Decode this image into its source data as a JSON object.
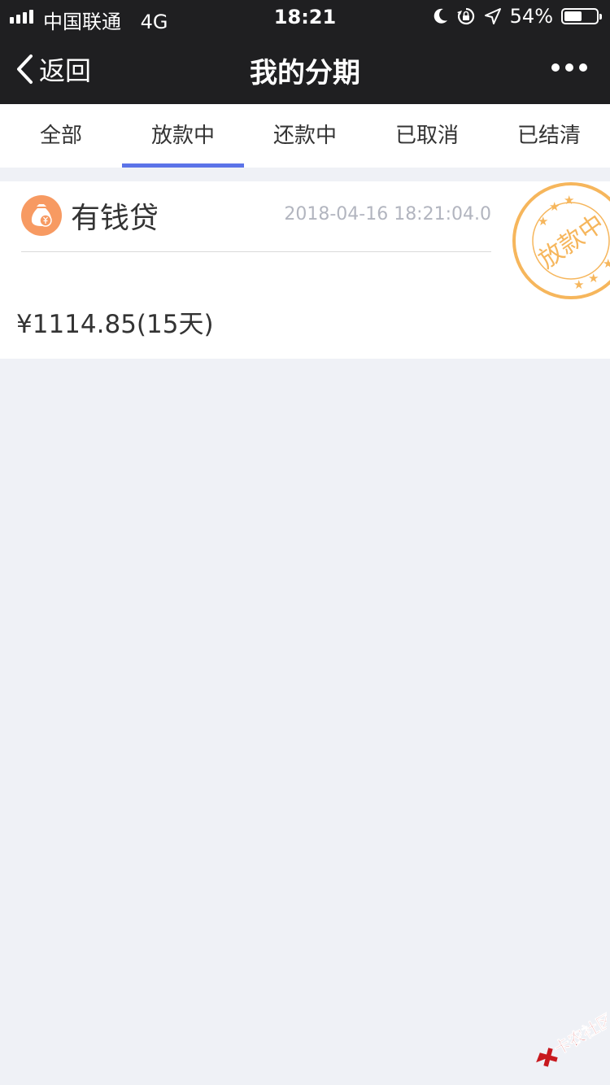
{
  "status_bar": {
    "carrier": "中国联通",
    "network": "4G",
    "time": "18:21",
    "battery": "54%",
    "battery_level": 0.54
  },
  "nav": {
    "back_label": "返回",
    "title": "我的分期"
  },
  "tabs": [
    {
      "label": "全部",
      "active": false
    },
    {
      "label": "放款中",
      "active": true
    },
    {
      "label": "还款中",
      "active": false
    },
    {
      "label": "已取消",
      "active": false
    },
    {
      "label": "已结清",
      "active": false
    }
  ],
  "loan": {
    "product_name": "有钱贷",
    "date": "2018-04-16 18:21:04.0",
    "amount": "¥1114.85(15天)",
    "stamp_text": "放款中",
    "icon": "money-bag-icon"
  },
  "watermark": {
    "text": "卡农社区"
  },
  "colors": {
    "bar_bg": "#1f1f21",
    "accent": "#5b73e8",
    "page_bg": "#eff1f6",
    "stamp": "#f6b65c",
    "icon_bg": "#f79a62"
  }
}
